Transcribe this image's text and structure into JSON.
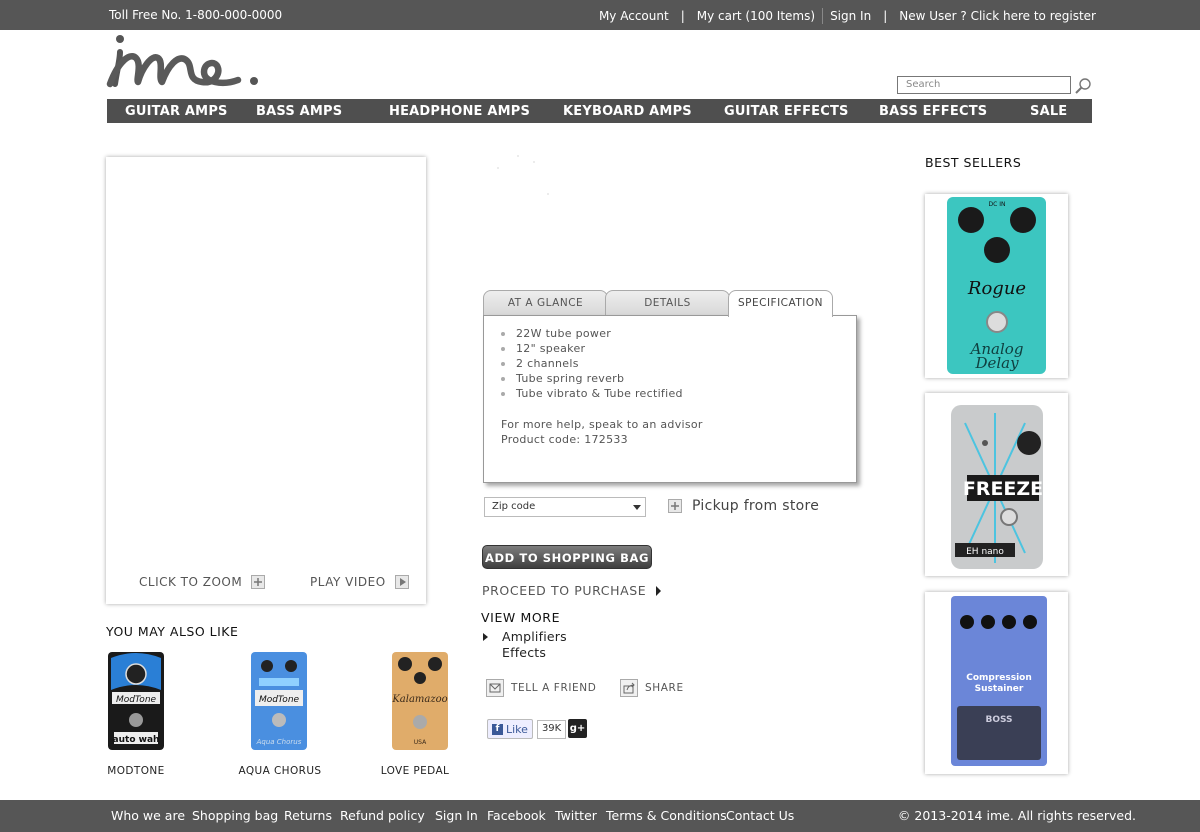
{
  "topbar": {
    "toll_free": "Toll Free No. 1-800-000-0000",
    "my_account": "My Account",
    "my_cart": "My cart (100 Items)",
    "sign_in": "Sign In",
    "register": "New User ? Click here to register"
  },
  "search": {
    "placeholder": "Search"
  },
  "nav": [
    "GUITAR AMPS",
    "BASS AMPS",
    "HEADPHONE AMPS",
    "KEYBOARD AMPS",
    "GUITAR EFFECTS",
    "BASS EFFECTS",
    "SALE"
  ],
  "image_box": {
    "zoom_label": "CLICK TO ZOOM",
    "video_label": "PLAY VIDEO"
  },
  "tabs": [
    "AT A GLANCE",
    "DETAILS",
    "SPECIFICATION"
  ],
  "active_tab": "SPECIFICATION",
  "spec": {
    "bullets": [
      "22W tube power",
      "12\" speaker",
      "2 channels",
      "Tube spring reverb",
      "Tube vibrato & Tube rectified"
    ],
    "help": "For more help, speak to an advisor",
    "product_code": "Product code: 172533"
  },
  "zip": {
    "value": "Zip code"
  },
  "pickup": "Pickup from store",
  "add_to_bag": "ADD TO SHOPPING BAG",
  "proceed": "PROCEED TO PURCHASE",
  "view_more": {
    "title": "VIEW MORE",
    "items": [
      "Amplifiers",
      "Effects"
    ]
  },
  "tell_friend": "TELL A FRIEND",
  "share": "SHARE",
  "facebook": {
    "like": "Like",
    "count": "39K"
  },
  "also_like": {
    "title": "YOU MAY ALSO LIKE",
    "items": [
      "MODTONE",
      "AQUA CHORUS",
      "LOVE PEDAL"
    ]
  },
  "best_sellers": {
    "title": "BEST SELLERS"
  },
  "footer": {
    "links": [
      "Who we are",
      "Shopping bag",
      "Returns",
      "Refund policy",
      "Sign In",
      "Facebook",
      "Twitter",
      "Terms & Conditions",
      "Contact Us"
    ],
    "copyright": "© 2013-2014 ime. All rights reserved."
  },
  "colors": {
    "bar": "#565656",
    "nav": "#4f4f4f",
    "teal_pedal": "#3cc6c0",
    "blue_pedal": "#6b86d8"
  }
}
